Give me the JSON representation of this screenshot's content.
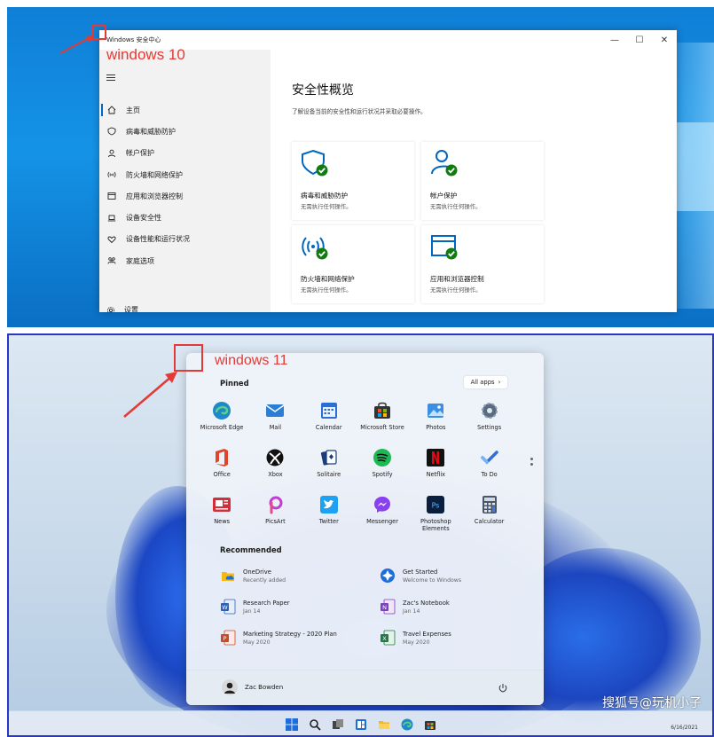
{
  "win10": {
    "annotation": "windows 10",
    "window_title": "Windows 安全中心",
    "controls": {
      "minimize": "—",
      "maximize": "☐",
      "close": "✕"
    },
    "nav": [
      {
        "label": "主页",
        "icon": "home-icon"
      },
      {
        "label": "病毒和威胁防护",
        "icon": "shield-icon"
      },
      {
        "label": "帐户保护",
        "icon": "person-icon"
      },
      {
        "label": "防火墙和网络保护",
        "icon": "wifi-icon"
      },
      {
        "label": "应用和浏览器控制",
        "icon": "browser-icon"
      },
      {
        "label": "设备安全性",
        "icon": "laptop-icon"
      },
      {
        "label": "设备性能和运行状况",
        "icon": "heart-icon"
      },
      {
        "label": "家庭选项",
        "icon": "family-icon"
      }
    ],
    "settings_label": "设置",
    "heading": "安全性概览",
    "subheading": "了解设备当前的安全性和运行状况并采取必要操作。",
    "cards": [
      {
        "title": "病毒和威胁防护",
        "status": "无需执行任何操作。",
        "icon": "shield-check-icon"
      },
      {
        "title": "帐户保护",
        "status": "无需执行任何操作。",
        "icon": "person-check-icon"
      },
      {
        "title": "防火墙和网络保护",
        "status": "无需执行任何操作。",
        "icon": "wifi-check-icon"
      },
      {
        "title": "应用和浏览器控制",
        "status": "无需执行任何操作。",
        "icon": "browser-check-icon"
      }
    ]
  },
  "win11": {
    "annotation": "windows 11",
    "pinned_label": "Pinned",
    "all_apps_label": "All apps",
    "apps": [
      {
        "name": "Microsoft Edge",
        "icon": "edge-icon",
        "color": "#1e88c8"
      },
      {
        "name": "Mail",
        "icon": "mail-icon",
        "color": "#2a7fd4"
      },
      {
        "name": "Calendar",
        "icon": "calendar-icon",
        "color": "#2d6fd0"
      },
      {
        "name": "Microsoft Store",
        "icon": "store-icon",
        "color": "#333333"
      },
      {
        "name": "Photos",
        "icon": "photos-icon",
        "color": "#3a8ee6"
      },
      {
        "name": "Settings",
        "icon": "settings-icon",
        "color": "#5a6b80"
      },
      {
        "name": "Office",
        "icon": "office-icon",
        "color": "#e0452b"
      },
      {
        "name": "Xbox",
        "icon": "xbox-icon",
        "color": "#111111"
      },
      {
        "name": "Solitaire",
        "icon": "solitaire-icon",
        "color": "#1b3d7a"
      },
      {
        "name": "Spotify",
        "icon": "spotify-icon",
        "color": "#1db954"
      },
      {
        "name": "Netflix",
        "icon": "netflix-icon",
        "color": "#111111"
      },
      {
        "name": "To Do",
        "icon": "todo-icon",
        "color": "#2f6fd8"
      },
      {
        "name": "News",
        "icon": "news-icon",
        "color": "#d0303a"
      },
      {
        "name": "PicsArt",
        "icon": "picsart-icon",
        "color": "#c03fd2"
      },
      {
        "name": "Twitter",
        "icon": "twitter-icon",
        "color": "#1da1f2"
      },
      {
        "name": "Messenger",
        "icon": "messenger-icon",
        "color": "#8a3ff0"
      },
      {
        "name": "Photoshop Elements",
        "icon": "photoshop-icon",
        "color": "#0a1f3d"
      },
      {
        "name": "Calculator",
        "icon": "calculator-icon",
        "color": "#4a5568"
      }
    ],
    "recommended_label": "Recommended",
    "recommended": [
      {
        "name": "OneDrive",
        "sub": "Recently added",
        "icon": "onedrive-icon"
      },
      {
        "name": "Get Started",
        "sub": "Welcome to Windows",
        "icon": "getstarted-icon"
      },
      {
        "name": "Research Paper",
        "sub": "Jan 14",
        "icon": "word-icon"
      },
      {
        "name": "Zac's Notebook",
        "sub": "Jan 14",
        "icon": "onenote-icon"
      },
      {
        "name": "Marketing Strategy - 2020 Plan",
        "sub": "May 2020",
        "icon": "powerpoint-icon"
      },
      {
        "name": "Travel Expenses",
        "sub": "May 2020",
        "icon": "excel-icon"
      }
    ],
    "user_name": "Zac Bowden",
    "taskbar_date": "6/16/2021",
    "watermark": "搜狐号@玩机小子"
  }
}
